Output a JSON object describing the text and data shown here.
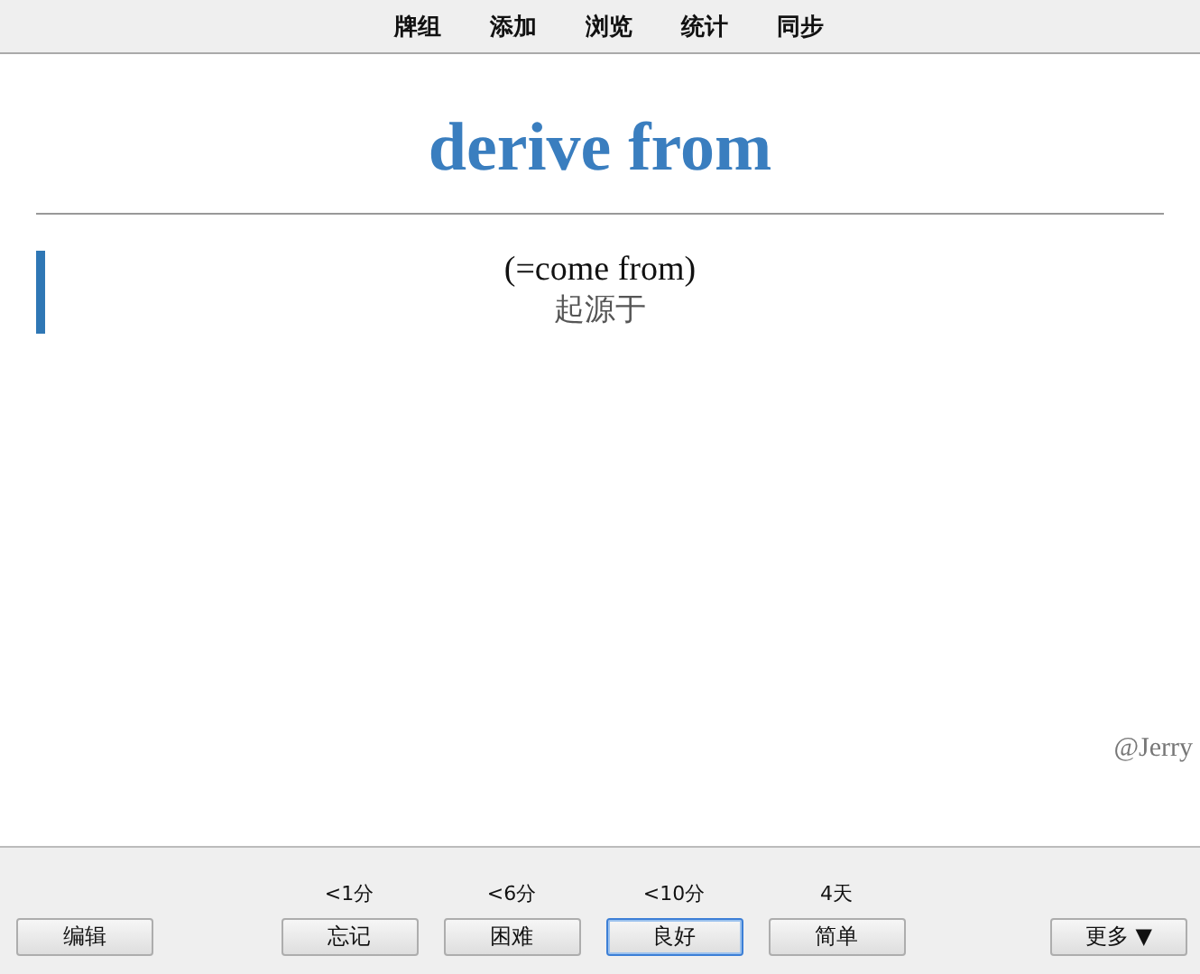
{
  "top_menu": [
    {
      "label": "牌组"
    },
    {
      "label": "添加"
    },
    {
      "label": "浏览"
    },
    {
      "label": "统计"
    },
    {
      "label": "同步"
    }
  ],
  "card": {
    "title": "derive from",
    "lines": [
      "(=come from)",
      "起源于"
    ],
    "signature": "@Jerry"
  },
  "bottom_bar": {
    "edit_button": "编辑",
    "answers": [
      {
        "interval": "<1分",
        "label": "忘记",
        "focused": false
      },
      {
        "interval": "<6分",
        "label": "困难",
        "focused": false
      },
      {
        "interval": "<10分",
        "label": "良好",
        "focused": true
      },
      {
        "interval": "4天",
        "label": "简单",
        "focused": false
      }
    ],
    "more_button": "更多 ▼"
  }
}
